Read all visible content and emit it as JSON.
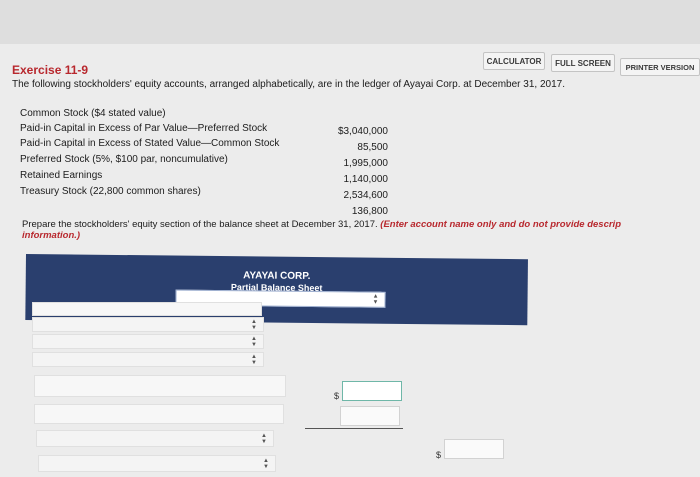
{
  "toolbar": {
    "calculator_label": "CALCULATOR",
    "full_screen_label": "FULL SCREEN",
    "printer_version_label": "PRINTER VERSION"
  },
  "exercise": {
    "title": "Exercise 11-9",
    "instructions": "The following stockholders' equity accounts, arranged alphabetically, are in the ledger of Ayayai Corp. at December 31, 2017."
  },
  "accounts": [
    {
      "name": "Common Stock ($4 stated value)",
      "value": "$3,040,000"
    },
    {
      "name": "Paid-in Capital in Excess of Par Value—Preferred Stock",
      "value": "85,500"
    },
    {
      "name": "Paid-in Capital in Excess of Stated Value—Common Stock",
      "value": "1,995,000"
    },
    {
      "name": "Preferred Stock (5%, $100 par, noncumulative)",
      "value": "1,140,000"
    },
    {
      "name": "Retained Earnings",
      "value": "2,534,600"
    },
    {
      "name": "Treasury Stock (22,800 common shares)",
      "value": "136,800"
    }
  ],
  "prompt": {
    "text": "Prepare the stockholders' equity section of the balance sheet at December 31, 2017.",
    "hint": "(Enter account name only and do not provide descrip",
    "hint_cont": "information.)"
  },
  "sheet": {
    "company": "AYAYAI CORP.",
    "subtitle": "Partial Balance Sheet"
  },
  "currency_symbol": "$",
  "colors": {
    "header_panel": "#2a3f6e",
    "exercise_title": "#b8282e",
    "active_input_border": "#6fb7a8"
  }
}
